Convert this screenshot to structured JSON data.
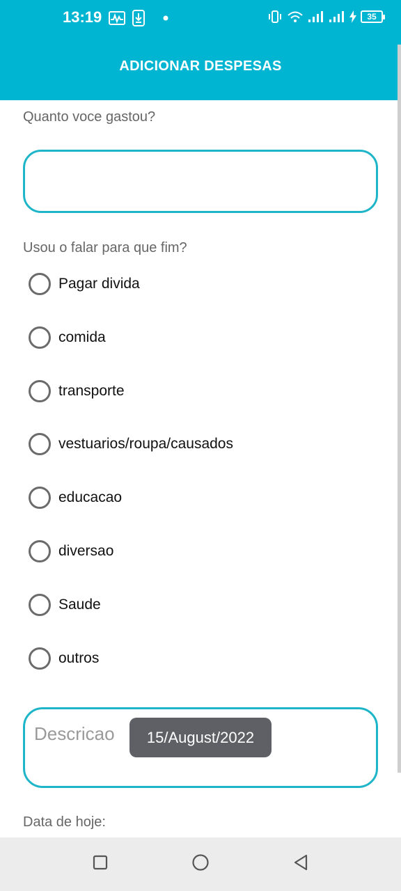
{
  "status_bar": {
    "time": "13:19",
    "left_icons": [
      "activity-icon",
      "download-icon",
      "dot-icon"
    ],
    "right_icons": [
      "vibrate-icon",
      "wifi-icon",
      "signal-icon",
      "signal-icon",
      "charging-icon"
    ],
    "battery": "35"
  },
  "app_bar": {
    "title": "ADICIONAR DESPESAS"
  },
  "form": {
    "amount_label": "Quanto voce gastou?",
    "amount_value": "",
    "purpose_label": "Usou o falar para que fim?",
    "options": [
      {
        "label": "Pagar divida",
        "selected": false
      },
      {
        "label": "comida",
        "selected": false
      },
      {
        "label": "transporte",
        "selected": false
      },
      {
        "label": "vestuarios/roupa/causados",
        "selected": false
      },
      {
        "label": "educacao",
        "selected": false
      },
      {
        "label": "diversao",
        "selected": false
      },
      {
        "label": "Saude",
        "selected": false
      },
      {
        "label": "outros",
        "selected": false
      }
    ],
    "description_placeholder": "Descricao",
    "date_label": "Data de hoje:"
  },
  "toast": {
    "text": "15/August/2022"
  },
  "nav_bar": {
    "buttons": [
      "recents-icon",
      "home-icon",
      "back-icon"
    ]
  },
  "colors": {
    "accent": "#00b5d1",
    "field_border": "#1fb5c8",
    "toast_bg": "#5e6066"
  }
}
